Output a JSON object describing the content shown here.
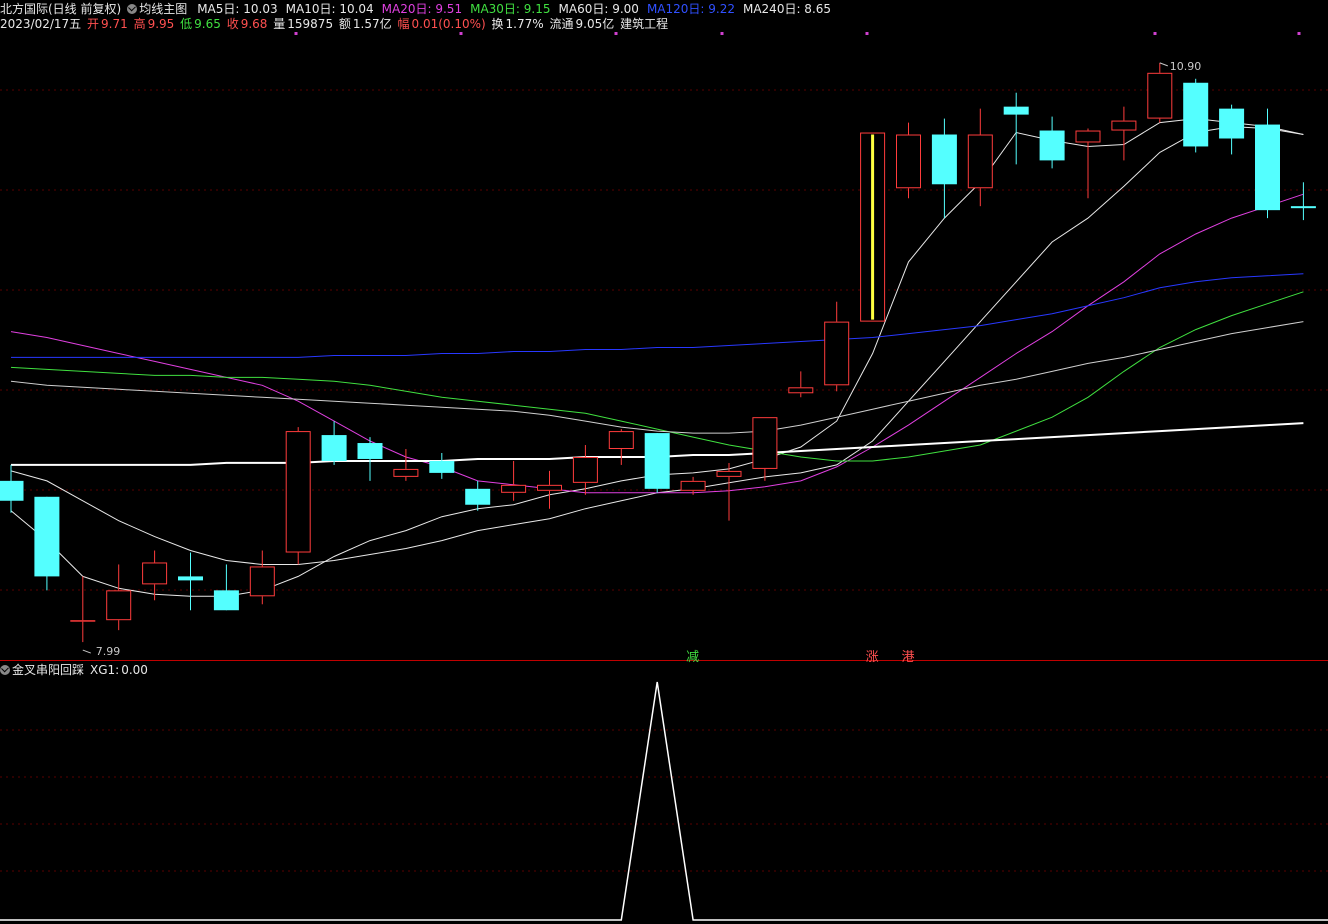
{
  "header": {
    "stock_title": "北方国际(日线 前复权)",
    "indicator_name": "均线主图",
    "ma": [
      {
        "label": "MA5日:",
        "value": "10.03",
        "color": "#e8e8e8"
      },
      {
        "label": "MA10日:",
        "value": "10.04",
        "color": "#e8e8e8"
      },
      {
        "label": "MA20日:",
        "value": "9.51",
        "color": "#e040e0"
      },
      {
        "label": "MA30日:",
        "value": "9.15",
        "color": "#40e040"
      },
      {
        "label": "MA60日:",
        "value": "9.00",
        "color": "#e8e8e8"
      },
      {
        "label": "MA120日:",
        "value": "9.22",
        "color": "#3050ff"
      },
      {
        "label": "MA240日:",
        "value": "8.65",
        "color": "#e8e8e8"
      }
    ]
  },
  "info": {
    "date": "2023/02/17五",
    "open_label": "开",
    "open": "9.71",
    "high_label": "高",
    "high": "9.95",
    "low_label": "低",
    "low": "9.65",
    "close_label": "收",
    "close": "9.68",
    "vol_label": "量",
    "vol": "159875",
    "amt_label": "额",
    "amt": "1.57亿",
    "chg_label": "幅",
    "chg": "0.01(0.10%)",
    "turn_label": "换",
    "turn": "1.77%",
    "float_label": "流通",
    "float": "9.05亿",
    "sector": "建筑工程"
  },
  "signals": [
    {
      "text": "减",
      "color": "#40e040",
      "index": 19
    },
    {
      "text": "涨",
      "color": "#ff5050",
      "index": 24
    },
    {
      "text": "港",
      "color": "#ff5050",
      "index": 25
    }
  ],
  "sub_panel": {
    "name": "金叉串阳回踩",
    "xg_label": "XG1:",
    "xg_value": "0.00"
  },
  "colors": {
    "up": "#ff3c3c",
    "down": "#54ffff",
    "axis": "#c00000",
    "grid": "#5a0000"
  },
  "chart_data": {
    "type": "candlestick",
    "price_range": [
      7.9,
      11.05
    ],
    "max_label": "10.90",
    "min_label": "7.99",
    "candles": [
      {
        "o": 8.8,
        "h": 8.88,
        "l": 8.64,
        "c": 8.7
      },
      {
        "o": 8.72,
        "h": 8.72,
        "l": 8.25,
        "c": 8.32
      },
      {
        "o": 8.1,
        "h": 8.32,
        "l": 7.99,
        "c": 8.1
      },
      {
        "o": 8.1,
        "h": 8.38,
        "l": 8.05,
        "c": 8.25
      },
      {
        "o": 8.28,
        "h": 8.45,
        "l": 8.2,
        "c": 8.39
      },
      {
        "o": 8.32,
        "h": 8.44,
        "l": 8.15,
        "c": 8.3
      },
      {
        "o": 8.25,
        "h": 8.38,
        "l": 8.15,
        "c": 8.15
      },
      {
        "o": 8.22,
        "h": 8.45,
        "l": 8.18,
        "c": 8.37
      },
      {
        "o": 8.44,
        "h": 9.07,
        "l": 8.38,
        "c": 9.05
      },
      {
        "o": 9.03,
        "h": 9.1,
        "l": 8.88,
        "c": 8.9
      },
      {
        "o": 8.99,
        "h": 9.02,
        "l": 8.8,
        "c": 8.91
      },
      {
        "o": 8.82,
        "h": 8.96,
        "l": 8.8,
        "c": 8.86
      },
      {
        "o": 8.9,
        "h": 8.94,
        "l": 8.81,
        "c": 8.84
      },
      {
        "o": 8.76,
        "h": 8.8,
        "l": 8.65,
        "c": 8.68
      },
      {
        "o": 8.74,
        "h": 8.9,
        "l": 8.7,
        "c": 8.78
      },
      {
        "o": 8.75,
        "h": 8.85,
        "l": 8.66,
        "c": 8.78
      },
      {
        "o": 8.79,
        "h": 8.98,
        "l": 8.73,
        "c": 8.92
      },
      {
        "o": 8.96,
        "h": 9.06,
        "l": 8.88,
        "c": 9.05
      },
      {
        "o": 9.04,
        "h": 9.04,
        "l": 8.74,
        "c": 8.76
      },
      {
        "o": 8.75,
        "h": 8.82,
        "l": 8.73,
        "c": 8.8
      },
      {
        "o": 8.82,
        "h": 8.89,
        "l": 8.6,
        "c": 8.85
      },
      {
        "o": 8.86,
        "h": 9.12,
        "l": 8.8,
        "c": 9.12
      },
      {
        "o": 9.24,
        "h": 9.35,
        "l": 9.22,
        "c": 9.27
      },
      {
        "o": 9.28,
        "h": 9.7,
        "l": 9.25,
        "c": 9.6
      },
      {
        "o": 9.6,
        "h": 10.55,
        "l": 9.6,
        "c": 10.55
      },
      {
        "o": 10.27,
        "h": 10.6,
        "l": 10.22,
        "c": 10.54
      },
      {
        "o": 10.54,
        "h": 10.62,
        "l": 10.12,
        "c": 10.29
      },
      {
        "o": 10.27,
        "h": 10.67,
        "l": 10.18,
        "c": 10.54
      },
      {
        "o": 10.68,
        "h": 10.75,
        "l": 10.39,
        "c": 10.64
      },
      {
        "o": 10.56,
        "h": 10.63,
        "l": 10.37,
        "c": 10.41
      },
      {
        "o": 10.5,
        "h": 10.57,
        "l": 10.22,
        "c": 10.56
      },
      {
        "o": 10.56,
        "h": 10.68,
        "l": 10.41,
        "c": 10.61
      },
      {
        "o": 10.62,
        "h": 10.9,
        "l": 10.6,
        "c": 10.85
      },
      {
        "o": 10.8,
        "h": 10.82,
        "l": 10.45,
        "c": 10.48
      },
      {
        "o": 10.67,
        "h": 10.69,
        "l": 10.44,
        "c": 10.52
      },
      {
        "o": 10.59,
        "h": 10.67,
        "l": 10.12,
        "c": 10.16
      },
      {
        "o": 10.18,
        "h": 10.3,
        "l": 10.11,
        "c": 10.17
      }
    ],
    "ma_series": [
      {
        "name": "MA5日",
        "color": "#e8e8e8",
        "width": 1,
        "values": [
          8.65,
          8.5,
          8.32,
          8.26,
          8.23,
          8.22,
          8.22,
          8.25,
          8.32,
          8.42,
          8.5,
          8.55,
          8.62,
          8.66,
          8.68,
          8.73,
          8.76,
          8.8,
          8.83,
          8.84,
          8.86,
          8.91,
          8.97,
          9.1,
          9.44,
          9.9,
          10.12,
          10.3,
          10.55,
          10.51,
          10.48,
          10.49,
          10.6,
          10.62,
          10.6,
          10.58,
          10.54
        ]
      },
      {
        "name": "MA10日",
        "color": "#e8e8e8",
        "width": 1,
        "values": [
          8.85,
          8.8,
          8.7,
          8.6,
          8.52,
          8.45,
          8.4,
          8.38,
          8.38,
          8.4,
          8.43,
          8.46,
          8.5,
          8.55,
          8.58,
          8.61,
          8.66,
          8.7,
          8.74,
          8.76,
          8.79,
          8.82,
          8.84,
          8.88,
          9.0,
          9.2,
          9.4,
          9.6,
          9.8,
          10.0,
          10.12,
          10.28,
          10.45,
          10.55,
          10.58,
          10.57,
          10.54
        ]
      },
      {
        "name": "MA20日",
        "color": "#e040e0",
        "width": 1,
        "values": [
          9.55,
          9.52,
          9.48,
          9.44,
          9.4,
          9.36,
          9.32,
          9.28,
          9.2,
          9.1,
          9.0,
          8.92,
          8.87,
          8.8,
          8.78,
          8.76,
          8.74,
          8.74,
          8.74,
          8.74,
          8.75,
          8.77,
          8.8,
          8.87,
          8.97,
          9.08,
          9.2,
          9.32,
          9.44,
          9.55,
          9.68,
          9.8,
          9.94,
          10.04,
          10.12,
          10.18,
          10.24
        ]
      },
      {
        "name": "MA30日",
        "color": "#40e040",
        "width": 1,
        "values": [
          9.37,
          9.36,
          9.35,
          9.34,
          9.33,
          9.33,
          9.32,
          9.32,
          9.31,
          9.3,
          9.28,
          9.25,
          9.22,
          9.2,
          9.18,
          9.16,
          9.14,
          9.1,
          9.06,
          9.02,
          8.98,
          8.95,
          8.92,
          8.9,
          8.9,
          8.92,
          8.95,
          8.98,
          9.05,
          9.12,
          9.22,
          9.35,
          9.47,
          9.56,
          9.63,
          9.69,
          9.75
        ]
      },
      {
        "name": "MA60日",
        "color": "#cfcfcf",
        "width": 1,
        "values": [
          9.3,
          9.28,
          9.27,
          9.26,
          9.25,
          9.24,
          9.23,
          9.22,
          9.21,
          9.2,
          9.19,
          9.18,
          9.17,
          9.16,
          9.15,
          9.13,
          9.1,
          9.07,
          9.05,
          9.04,
          9.04,
          9.05,
          9.08,
          9.12,
          9.16,
          9.2,
          9.24,
          9.28,
          9.31,
          9.35,
          9.39,
          9.42,
          9.46,
          9.5,
          9.54,
          9.57,
          9.6
        ]
      },
      {
        "name": "MA120日",
        "color": "#2838ff",
        "width": 1,
        "values": [
          9.42,
          9.42,
          9.42,
          9.42,
          9.42,
          9.42,
          9.42,
          9.42,
          9.42,
          9.43,
          9.43,
          9.43,
          9.44,
          9.44,
          9.45,
          9.45,
          9.46,
          9.46,
          9.47,
          9.47,
          9.48,
          9.49,
          9.5,
          9.51,
          9.52,
          9.54,
          9.56,
          9.58,
          9.61,
          9.64,
          9.68,
          9.72,
          9.77,
          9.8,
          9.82,
          9.83,
          9.84
        ]
      },
      {
        "name": "MA240日",
        "color": "#ffffff",
        "width": 2,
        "values": [
          8.88,
          8.88,
          8.88,
          8.88,
          8.88,
          8.88,
          8.89,
          8.89,
          8.89,
          8.9,
          8.9,
          8.9,
          8.9,
          8.91,
          8.91,
          8.91,
          8.92,
          8.92,
          8.92,
          8.93,
          8.93,
          8.94,
          8.95,
          8.96,
          8.97,
          8.98,
          8.99,
          9.0,
          9.01,
          9.02,
          9.03,
          9.04,
          9.05,
          9.06,
          9.07,
          9.08,
          9.09
        ]
      }
    ],
    "xg1_values": [
      0,
      0,
      0,
      0,
      0,
      0,
      0,
      0,
      0,
      0,
      0,
      0,
      0,
      0,
      0,
      0,
      0,
      0,
      1,
      0,
      0,
      0,
      0,
      0,
      0,
      0,
      0,
      0,
      0,
      0,
      0,
      0,
      0,
      0,
      0,
      0,
      0
    ]
  }
}
